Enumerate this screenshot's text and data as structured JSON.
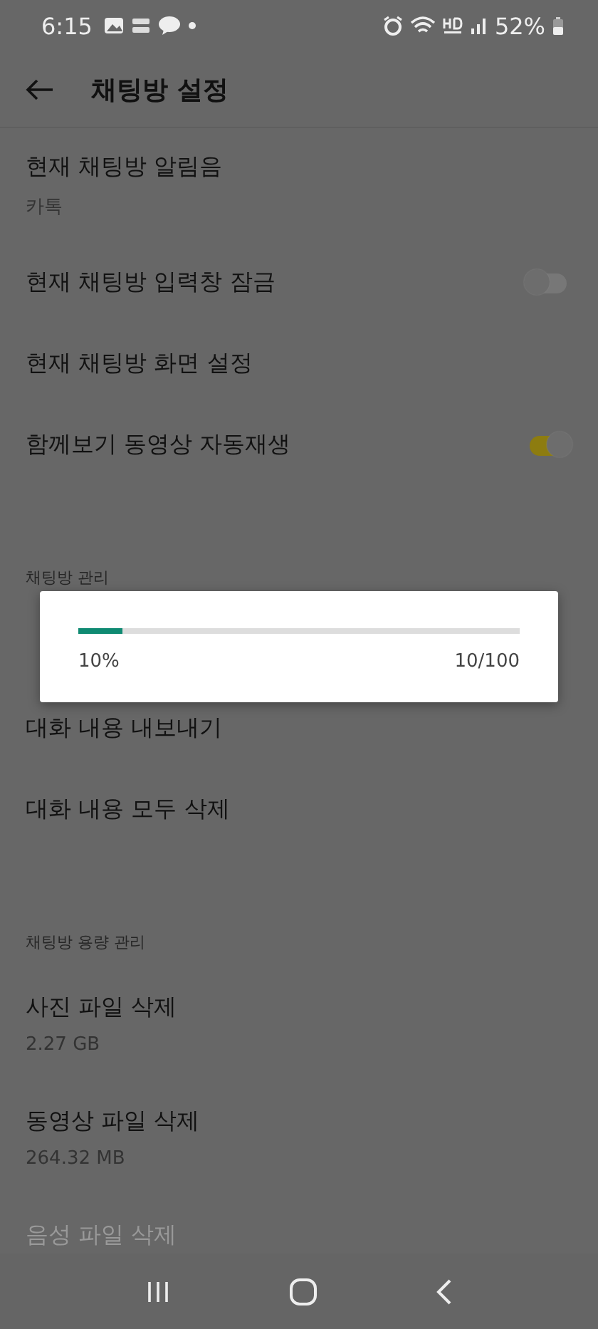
{
  "status_bar": {
    "time": "6:15",
    "battery": "52%"
  },
  "header": {
    "title": "채팅방 설정"
  },
  "sections": [
    {
      "items": [
        {
          "kind": "text",
          "title": "현재 채팅방 알림음",
          "subtitle": "카톡",
          "disabled": false
        },
        {
          "kind": "toggle",
          "title": "현재 채팅방 입력창 잠금",
          "on": false,
          "disabled": false
        },
        {
          "kind": "text",
          "title": "현재 채팅방 화면 설정",
          "disabled": false
        },
        {
          "kind": "toggle",
          "title": "함께보기 동영상 자동재생",
          "on": true,
          "disabled": false
        }
      ]
    },
    {
      "header": "채팅방 관리",
      "items": [
        {
          "kind": "text",
          "title": "대화 내용 내보내기",
          "disabled": false
        },
        {
          "kind": "text",
          "title": "대화 내용 모두 삭제",
          "disabled": false
        }
      ]
    },
    {
      "header": "채팅방 용량 관리",
      "items": [
        {
          "kind": "text",
          "title": "사진 파일 삭제",
          "subtitle": "2.27 GB",
          "disabled": false
        },
        {
          "kind": "text",
          "title": "동영상 파일 삭제",
          "subtitle": "264.32 MB",
          "disabled": false
        },
        {
          "kind": "text",
          "title": "음성 파일 삭제",
          "disabled": true
        }
      ]
    }
  ],
  "progress_dialog": {
    "level": 0.1,
    "percent": "10%",
    "count": "10/100"
  }
}
